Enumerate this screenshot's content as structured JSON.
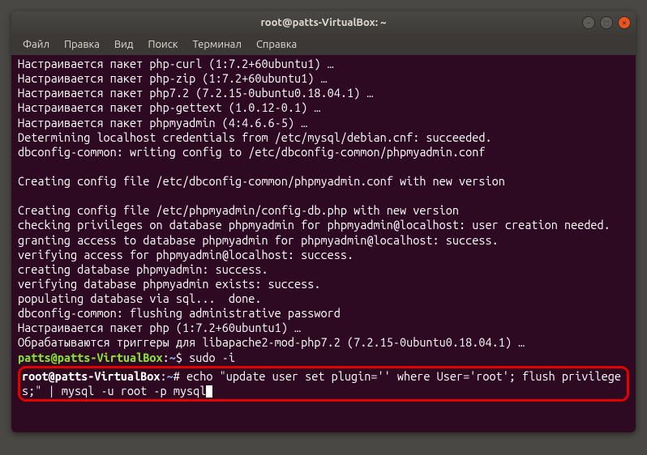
{
  "window": {
    "title": "root@patts-VirtualBox: ~"
  },
  "menu": {
    "file": "Файл",
    "edit": "Правка",
    "view": "Вид",
    "search": "Поиск",
    "terminal": "Терминал",
    "help": "Справка"
  },
  "lines": {
    "l0": "Настраивается пакет php-curl (1:7.2+60ubuntu1) …",
    "l1": "Настраивается пакет php-zip (1:7.2+60ubuntu1) …",
    "l2": "Настраивается пакет php7.2 (7.2.15-0ubuntu0.18.04.1) …",
    "l3": "Настраивается пакет php-gettext (1.0.12-0.1) …",
    "l4": "Настраивается пакет phpmyadmin (4:4.6.6-5) …",
    "l5": "Determining localhost credentials from /etc/mysql/debian.cnf: succeeded.",
    "l6": "dbconfig-common: writing config to /etc/dbconfig-common/phpmyadmin.conf",
    "l7": " ",
    "l8": "Creating config file /etc/dbconfig-common/phpmyadmin.conf with new version",
    "l9": " ",
    "l10": "Creating config file /etc/phpmyadmin/config-db.php with new version",
    "l11": "checking privileges on database phpmyadmin for phpmyadmin@localhost: user creation needed.",
    "l12": "granting access to database phpmyadmin for phpmyadmin@localhost: success.",
    "l13": "verifying access for phpmyadmin@localhost: success.",
    "l14": "creating database phpmyadmin: success.",
    "l15": "verifying database phpmyadmin exists: success.",
    "l16": "populating database via sql...  done.",
    "l17": "dbconfig-common: flushing administrative password",
    "l18": "Настраивается пакет php (1:7.2+60ubuntu1) …",
    "l19": "Обрабатываются триггеры для libapache2-mod-php7.2 (7.2.15-0ubuntu0.18.04.1) …"
  },
  "prompt1": {
    "user": "patts@patts-VirtualBox",
    "colon": ":",
    "path": "~",
    "sym": "$",
    "cmd": " sudo -i"
  },
  "prompt2": {
    "user": "root@patts-VirtualBox",
    "colon": ":",
    "path": "~",
    "sym": "#",
    "cmd": " echo \"update user set plugin='' where User='root'; flush privileges;\" | mysql -u root -p mysql"
  }
}
